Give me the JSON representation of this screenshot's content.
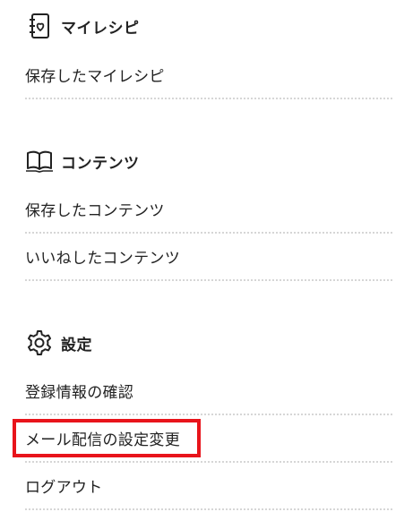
{
  "sections": [
    {
      "icon": "recipe-notebook-icon",
      "title": "マイレシピ",
      "items": [
        {
          "label": "保存したマイレシピ"
        }
      ]
    },
    {
      "icon": "open-book-icon",
      "title": "コンテンツ",
      "items": [
        {
          "label": "保存したコンテンツ"
        },
        {
          "label": "いいねしたコンテンツ"
        }
      ]
    },
    {
      "icon": "gear-icon",
      "title": "設定",
      "items": [
        {
          "label": "登録情報の確認"
        },
        {
          "label": "メール配信の設定変更",
          "highlighted": true
        },
        {
          "label": "ログアウト"
        }
      ]
    }
  ],
  "colors": {
    "text": "#222222",
    "divider": "#d6d6d6",
    "highlight": "#e8141b"
  }
}
